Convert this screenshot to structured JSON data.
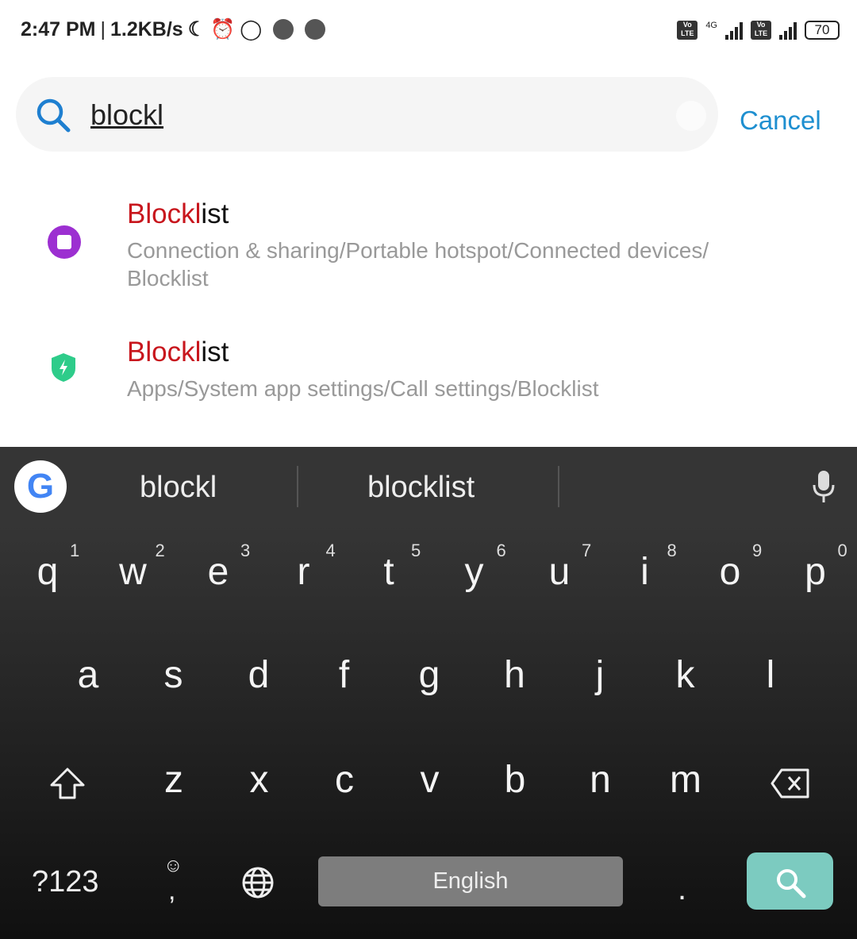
{
  "status": {
    "time": "2:47 PM",
    "speed": "1.2KB/s",
    "network": "4G",
    "volte": "Vo LTE",
    "battery": "70"
  },
  "search": {
    "query": "blockl",
    "cancel": "Cancel"
  },
  "results": [
    {
      "title_match": "Blockl",
      "title_rest": "ist",
      "path": "Connection & sharing/Portable hotspot/Connected devices/ Blocklist",
      "icon": "settings-gear-icon",
      "color": "#9c2fd1"
    },
    {
      "title_match": "Blockl",
      "title_rest": "ist",
      "path": "Apps/System app settings/Call settings/Blocklist",
      "icon": "shield-bolt-icon",
      "color": "#2ecc8a"
    }
  ],
  "keyboard": {
    "suggestions": [
      "blockl",
      "blocklist"
    ],
    "row1": [
      [
        "q",
        "1"
      ],
      [
        "w",
        "2"
      ],
      [
        "e",
        "3"
      ],
      [
        "r",
        "4"
      ],
      [
        "t",
        "5"
      ],
      [
        "y",
        "6"
      ],
      [
        "u",
        "7"
      ],
      [
        "i",
        "8"
      ],
      [
        "o",
        "9"
      ],
      [
        "p",
        "0"
      ]
    ],
    "row2": [
      "a",
      "s",
      "d",
      "f",
      "g",
      "h",
      "j",
      "k",
      "l"
    ],
    "row3": [
      "z",
      "x",
      "c",
      "v",
      "b",
      "n",
      "m"
    ],
    "symbols": "?123",
    "comma": ",",
    "period": ".",
    "space": "English"
  }
}
